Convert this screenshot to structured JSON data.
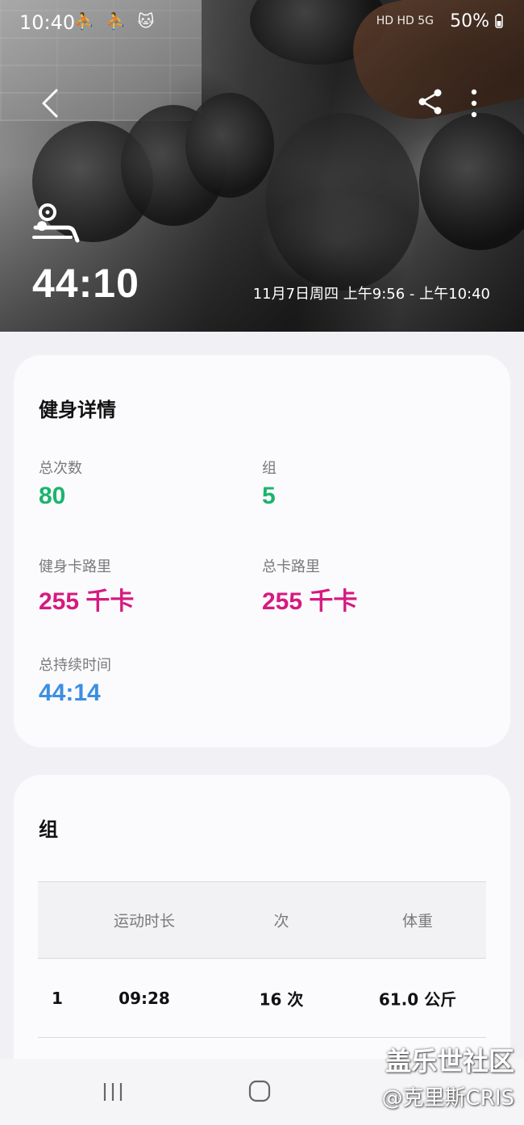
{
  "status_bar": {
    "time": "10:40",
    "left_icons": "⛹ ⛹ 🐱",
    "signal_text": "HD HD 5G",
    "battery": "50%"
  },
  "header": {
    "workout_icon": "bench-press-icon",
    "duration": "44:10",
    "date_range": "11月7日周四 上午9:56 - 上午10:40"
  },
  "details": {
    "title": "健身详情",
    "total_reps_label": "总次数",
    "total_reps_value": "80",
    "sets_label": "组",
    "sets_value": "5",
    "workout_calories_label": "健身卡路里",
    "workout_calories_value": "255 千卡",
    "total_calories_label": "总卡路里",
    "total_calories_value": "255 千卡",
    "total_duration_label": "总持续时间",
    "total_duration_value": "44:14"
  },
  "sets": {
    "title": "组",
    "columns": [
      "",
      "运动时长",
      "次",
      "体重"
    ],
    "rows": [
      {
        "index": "1",
        "duration": "09:28",
        "reps": "16 次",
        "weight": "61.0 公斤"
      }
    ]
  },
  "watermark": {
    "line1": "盖乐世社区",
    "line2": "@克里斯CRIS"
  },
  "colors": {
    "green": "#1bb46d",
    "pink": "#d61a7f",
    "blue": "#3e8ee0"
  }
}
